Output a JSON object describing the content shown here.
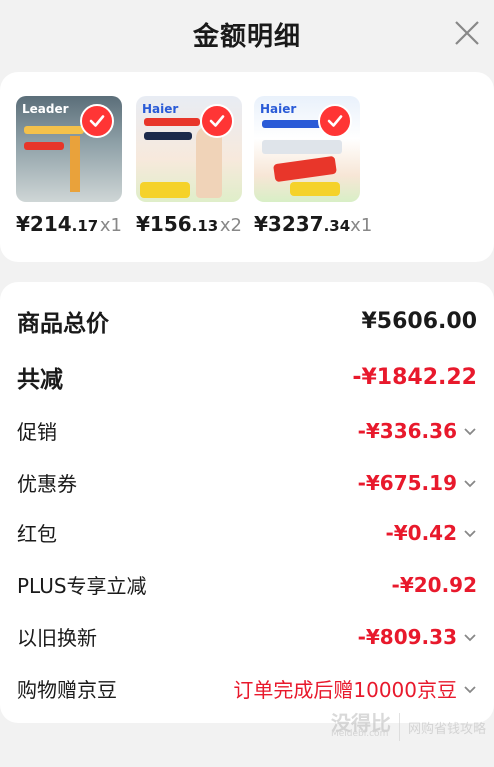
{
  "header": {
    "title": "金额明细"
  },
  "products": [
    {
      "brand": "Leader",
      "price_symbol": "¥",
      "price_int": "214",
      "price_dec": ".17",
      "qty": "x1"
    },
    {
      "brand": "Haier",
      "price_symbol": "¥",
      "price_int": "156",
      "price_dec": ".13",
      "qty": "x2"
    },
    {
      "brand": "Haier",
      "price_symbol": "¥",
      "price_int": "3237",
      "price_dec": ".34",
      "qty": "x1"
    }
  ],
  "summary": {
    "total_label": "商品总价",
    "total_value": "¥5606.00",
    "reduce_label": "共减",
    "reduce_value": "-¥1842.22",
    "promo_label": "促销",
    "promo_value": "-¥336.36",
    "coupon_label": "优惠券",
    "coupon_value": "-¥675.19",
    "redpacket_label": "红包",
    "redpacket_value": "-¥0.42",
    "plus_label": "PLUS专享立减",
    "plus_value": "-¥20.92",
    "tradein_label": "以旧换新",
    "tradein_value": "-¥809.33",
    "beans_label": "购物赠京豆",
    "beans_value": "订单完成后赠10000京豆"
  },
  "watermark": {
    "logo": "没得比",
    "sub": "Meidebi.com",
    "text": "网购省钱攻略"
  },
  "colors": {
    "accent_red": "#e8192c",
    "check_red": "#ff3535"
  }
}
